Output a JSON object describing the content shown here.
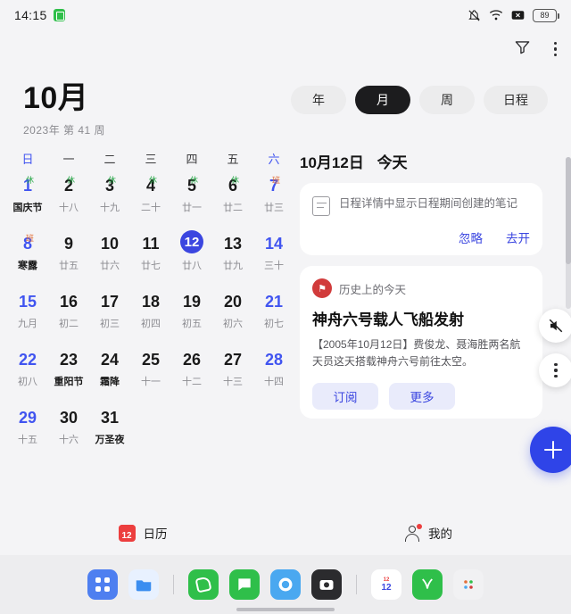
{
  "status_bar": {
    "time": "14:15",
    "battery_text": "89",
    "icons": [
      "bell-off-icon",
      "wifi-icon",
      "signal-x-icon",
      "battery-icon"
    ]
  },
  "toolbar": {
    "filter_icon": "filter-icon",
    "more_icon": "more-vertical-icon"
  },
  "header": {
    "month_title": "10月",
    "sub_title": "2023年 第 41 周",
    "segments": [
      {
        "label": "年",
        "active": false
      },
      {
        "label": "月",
        "active": true
      },
      {
        "label": "周",
        "active": false
      },
      {
        "label": "日程",
        "active": false
      }
    ]
  },
  "calendar": {
    "weekdays": [
      "日",
      "一",
      "二",
      "三",
      "四",
      "五",
      "六"
    ],
    "days": [
      {
        "num": "1",
        "lunar": "国庆节",
        "festival": true,
        "weekend": true,
        "tag": "休"
      },
      {
        "num": "2",
        "lunar": "十八",
        "tag": "休"
      },
      {
        "num": "3",
        "lunar": "十九",
        "tag": "休"
      },
      {
        "num": "4",
        "lunar": "二十",
        "tag": "休"
      },
      {
        "num": "5",
        "lunar": "廿一",
        "tag": "休"
      },
      {
        "num": "6",
        "lunar": "廿二",
        "tag": "休"
      },
      {
        "num": "7",
        "lunar": "廿三",
        "weekend": true,
        "tag": "班"
      },
      {
        "num": "8",
        "lunar": "寒露",
        "festival": true,
        "weekend": true,
        "tag": "班"
      },
      {
        "num": "9",
        "lunar": "廿五"
      },
      {
        "num": "10",
        "lunar": "廿六"
      },
      {
        "num": "11",
        "lunar": "廿七"
      },
      {
        "num": "12",
        "lunar": "廿八",
        "selected": true
      },
      {
        "num": "13",
        "lunar": "廿九"
      },
      {
        "num": "14",
        "lunar": "三十",
        "weekend": true
      },
      {
        "num": "15",
        "lunar": "九月",
        "weekend": true
      },
      {
        "num": "16",
        "lunar": "初二"
      },
      {
        "num": "17",
        "lunar": "初三"
      },
      {
        "num": "18",
        "lunar": "初四"
      },
      {
        "num": "19",
        "lunar": "初五"
      },
      {
        "num": "20",
        "lunar": "初六"
      },
      {
        "num": "21",
        "lunar": "初七",
        "weekend": true
      },
      {
        "num": "22",
        "lunar": "初八",
        "weekend": true
      },
      {
        "num": "23",
        "lunar": "重阳节",
        "festival": true
      },
      {
        "num": "24",
        "lunar": "霜降",
        "festival": true
      },
      {
        "num": "25",
        "lunar": "十一"
      },
      {
        "num": "26",
        "lunar": "十二"
      },
      {
        "num": "27",
        "lunar": "十三"
      },
      {
        "num": "28",
        "lunar": "十四",
        "weekend": true
      },
      {
        "num": "29",
        "lunar": "十五",
        "weekend": true
      },
      {
        "num": "30",
        "lunar": "十六"
      },
      {
        "num": "31",
        "lunar": "万圣夜",
        "festival": true
      }
    ]
  },
  "detail": {
    "date_label": "10月12日",
    "today_label": "今天",
    "note_card": {
      "text": "日程详情中显示日程期间创建的笔记",
      "dismiss_label": "忽略",
      "go_label": "去开"
    },
    "history_card": {
      "badge_icon": "history-icon",
      "section_label": "历史上的今天",
      "title": "神舟六号载人飞船发射",
      "body": "【2005年10月12日】费俊龙、聂海胜两名航天员这天搭载神舟六号前往太空。",
      "subscribe_label": "订阅",
      "more_label": "更多"
    },
    "mute_icon": "mute-icon",
    "more_icon": "more-vertical-icon",
    "add_icon": "plus-icon"
  },
  "bottom_nav": [
    {
      "label": "日历",
      "icon": "calendar-icon",
      "badge": "12",
      "active": true
    },
    {
      "label": "我的",
      "icon": "person-icon",
      "active": false
    }
  ],
  "dock": {
    "apps": [
      {
        "name": "app-drawer",
        "color": "#4e7ff0",
        "glyph": "grid"
      },
      {
        "name": "files",
        "color": "#3a8df0",
        "glyph": "files"
      },
      {
        "name": "phone",
        "color": "#2fbf4a",
        "glyph": "phone"
      },
      {
        "name": "messages",
        "color": "#2fbf4a",
        "glyph": "message"
      },
      {
        "name": "browser",
        "color": "#4aa8f0",
        "glyph": "browser"
      },
      {
        "name": "camera",
        "color": "#2b2b2e",
        "glyph": "camera"
      },
      {
        "name": "calendar",
        "color": "#ffffff",
        "glyph": "cal",
        "label": "12"
      },
      {
        "name": "health",
        "color": "#2fbf4a",
        "glyph": "health"
      },
      {
        "name": "more-apps",
        "color": "#f1f1f3",
        "glyph": "dots"
      }
    ]
  },
  "colors": {
    "accent": "#3b46e0",
    "selected_day": "#3b46e0",
    "rest_tag": "#2aa84a",
    "work_tag": "#e2703a",
    "weekend_text": "#4054f0"
  }
}
